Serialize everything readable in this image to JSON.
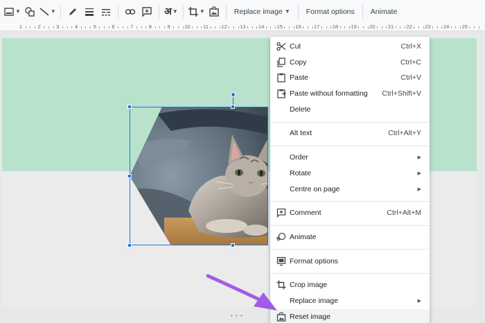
{
  "toolbar": {
    "replace_image": "Replace image",
    "format_options": "Format options",
    "animate": "Animate",
    "input_tools_glyph": "अ"
  },
  "ruler": {
    "labels": [
      "1",
      "2",
      "3",
      "4",
      "5",
      "6",
      "7",
      "8",
      "9",
      "10",
      "11",
      "12",
      "13",
      "14",
      "15",
      "16",
      "17",
      "18",
      "19",
      "20",
      "21",
      "22",
      "23",
      "24",
      "25"
    ]
  },
  "context_menu": {
    "cut": {
      "label": "Cut",
      "shortcut": "Ctrl+X",
      "icon": "scissors-icon"
    },
    "copy": {
      "label": "Copy",
      "shortcut": "Ctrl+C",
      "icon": "copy-icon"
    },
    "paste": {
      "label": "Paste",
      "shortcut": "Ctrl+V",
      "icon": "clipboard-icon"
    },
    "paste_plain": {
      "label": "Paste without formatting",
      "shortcut": "Ctrl+Shift+V",
      "icon": "paste-plain-icon"
    },
    "delete": {
      "label": "Delete"
    },
    "alt_text": {
      "label": "Alt text",
      "shortcut": "Ctrl+Alt+Y"
    },
    "order": {
      "label": "Order"
    },
    "rotate": {
      "label": "Rotate"
    },
    "centre": {
      "label": "Centre on page"
    },
    "comment": {
      "label": "Comment",
      "shortcut": "Ctrl+Alt+M",
      "icon": "comment-plus-icon"
    },
    "animate": {
      "label": "Animate",
      "icon": "animate-icon"
    },
    "format": {
      "label": "Format options",
      "icon": "format-options-icon"
    },
    "crop": {
      "label": "Crop image",
      "icon": "crop-icon"
    },
    "replace": {
      "label": "Replace image"
    },
    "reset": {
      "label": "Reset image",
      "icon": "reset-image-icon"
    }
  },
  "colors": {
    "accent": "#1a73e8",
    "slide_band": "#b8e2cc",
    "annotation_arrow": "#a05ce8"
  },
  "canvas": {
    "bottom_dots": "• • •"
  }
}
